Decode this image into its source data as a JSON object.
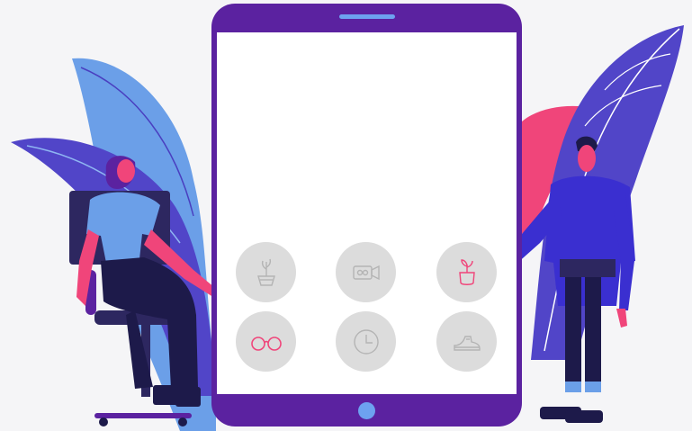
{
  "colors": {
    "background": "#f5f5f7",
    "tablet_frame": "#5b22a0",
    "screen": "#ffffff",
    "accent_blue": "#6da2f0",
    "app_circle": "#dcdcdc",
    "icon_gray": "#b4b4b4",
    "icon_pink": "#f0457a",
    "skin": "#f0457a",
    "navy": "#1d1a4a",
    "leaf_blue": "#6b9fe8",
    "leaf_purple": "#5145c8"
  },
  "apps": [
    {
      "icon": "plant-pot-icon"
    },
    {
      "icon": "video-camera-icon"
    },
    {
      "icon": "sprout-cup-icon"
    },
    {
      "icon": "glasses-icon"
    },
    {
      "icon": "clock-icon"
    },
    {
      "icon": "sneaker-icon"
    }
  ]
}
